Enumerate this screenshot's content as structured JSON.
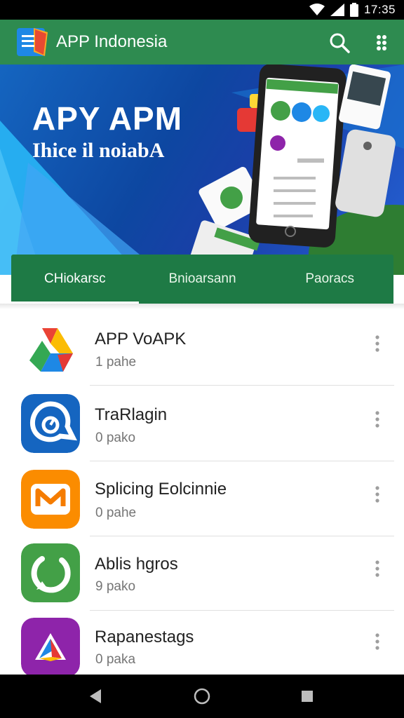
{
  "status_bar": {
    "time": "17:35",
    "icons": [
      "wifi-icon",
      "signal-icon",
      "battery-icon"
    ]
  },
  "app_bar": {
    "title": "APP Indonesia",
    "icons": [
      "menu-logo-icon",
      "search-icon",
      "more-vert-icon"
    ],
    "color": "#2e8b50"
  },
  "banner": {
    "title": "APY APM",
    "subtitle": "Ihice il noiabA"
  },
  "tabs": [
    {
      "label": "CHiokarsc",
      "active": true
    },
    {
      "label": "Bnioarsann",
      "active": false
    },
    {
      "label": "Paoracs",
      "active": false
    }
  ],
  "apps": [
    {
      "name": "APP VoAPK",
      "sub": "1 pahe",
      "icon": "google-drive-like-icon"
    },
    {
      "name": "TraRlagin",
      "sub": "0 pako",
      "icon": "blue-clock-app-icon"
    },
    {
      "name": "Splicing Eolcinnie",
      "sub": "0 pahe",
      "icon": "orange-mail-icon"
    },
    {
      "name": "Ablis hgros",
      "sub": "9 pako",
      "icon": "green-whatsapp-like-icon"
    },
    {
      "name": "Rapanestags",
      "sub": "0 paka",
      "icon": "purple-play-icon"
    }
  ],
  "nav": [
    "back-icon",
    "home-icon",
    "recents-icon"
  ]
}
